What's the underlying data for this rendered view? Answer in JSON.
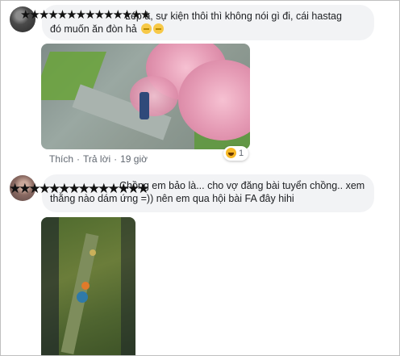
{
  "comments": [
    {
      "author_masked": "★★★★★★★★★★★★★★",
      "text_line1": "Lép à, sự kiện thôi thì không nói gì đi, cái hastag",
      "text_line2": "đó muốn ăn đòn hả",
      "emojis": [
        "expressionless-face",
        "expressionless-face"
      ],
      "actions": {
        "like": "Thích",
        "reply": "Trả lời",
        "time": "19 giờ"
      },
      "reaction": {
        "icon": "haha-reaction",
        "count": "1"
      }
    },
    {
      "author_masked": "★★★★★★★★★★★★★★",
      "text_line1": "Chồng em bảo là... cho vợ đăng bài tuyển chồng.. xem",
      "text_line2": "thằng nào dám ứng =)) nên em qua hội bài FA đây hihi"
    }
  ]
}
